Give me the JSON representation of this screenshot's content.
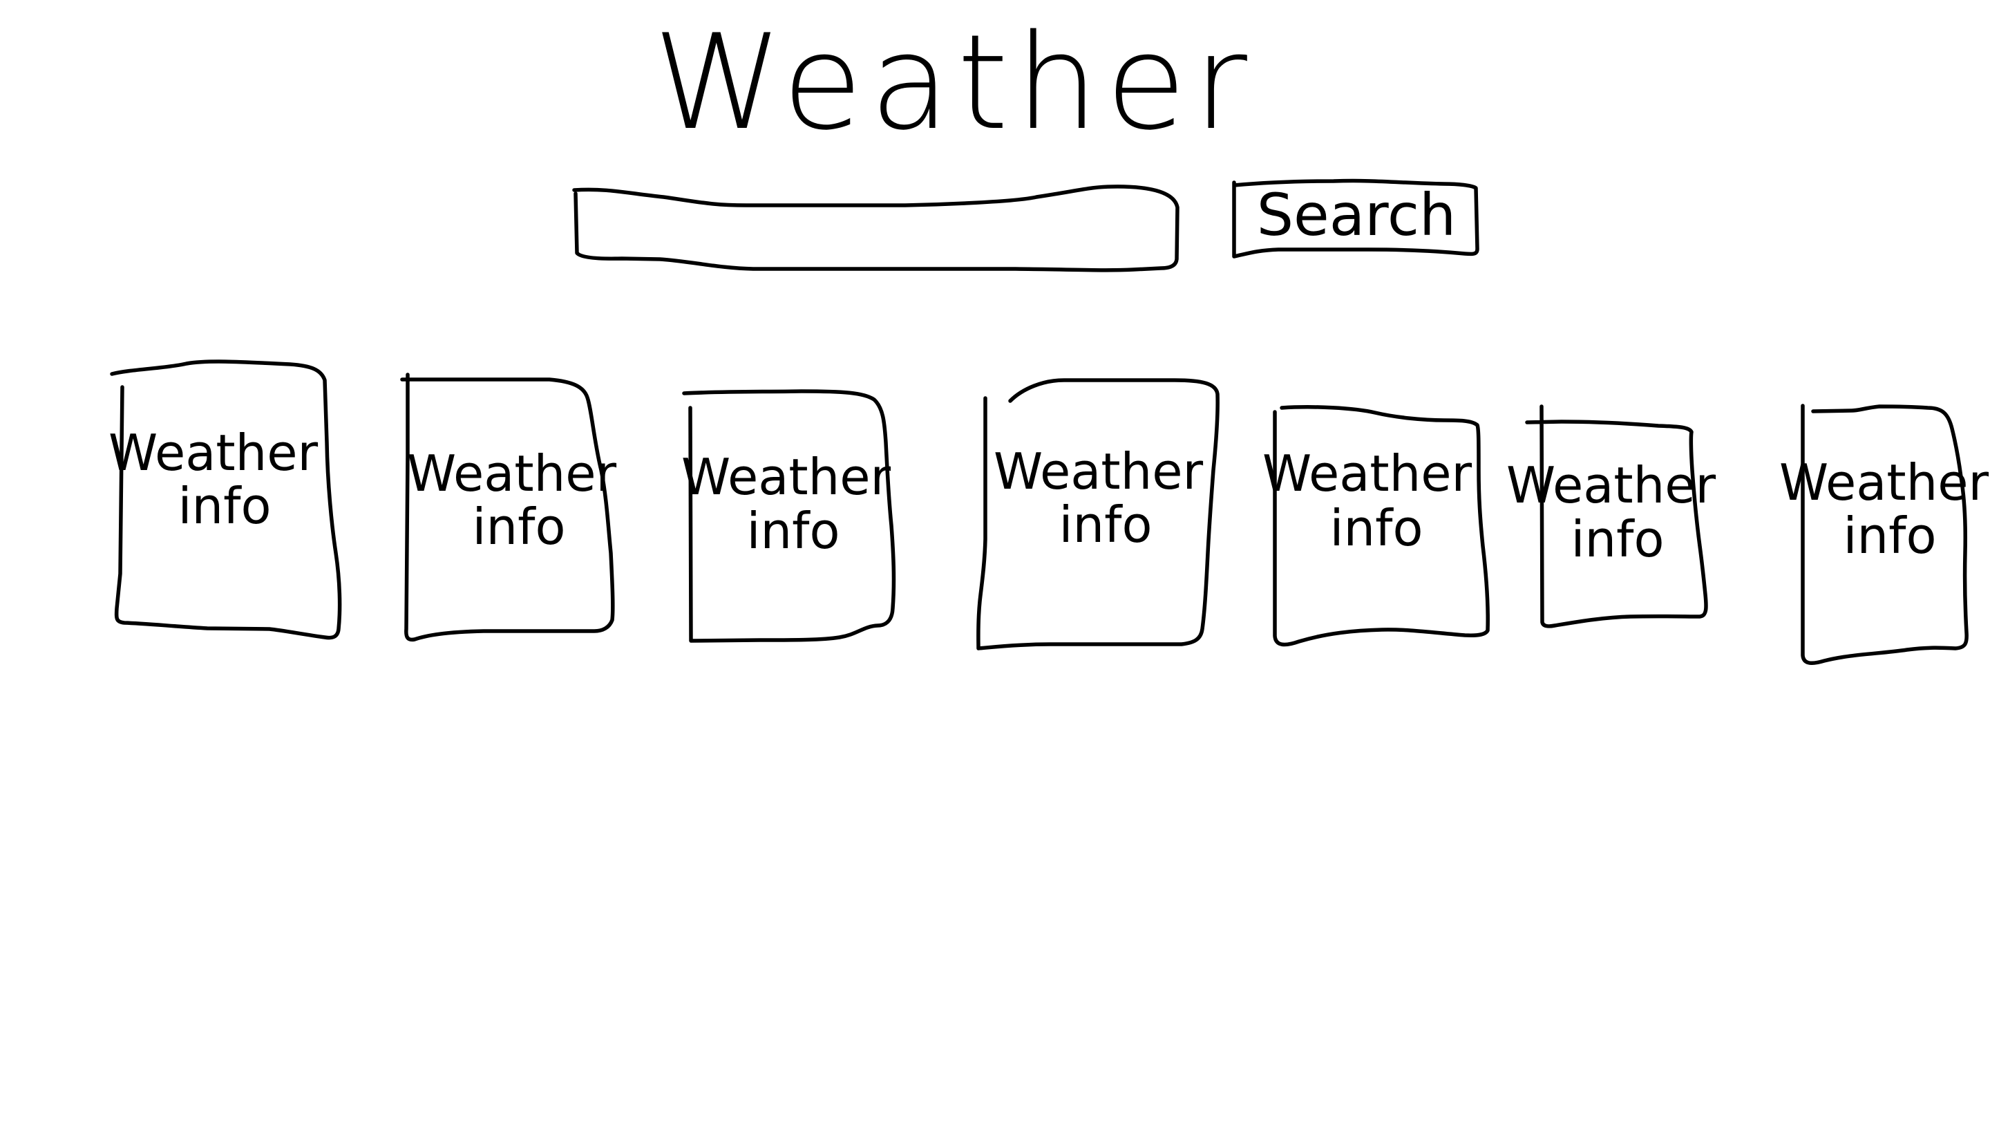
{
  "page": {
    "title": "Weather"
  },
  "search": {
    "input_value": "",
    "button_label": "Search"
  },
  "cards": [
    {
      "line1": "Weather",
      "line2": "info"
    },
    {
      "line1": "Weather",
      "line2": "info"
    },
    {
      "line1": "Weather",
      "line2": "info"
    },
    {
      "line1": "Weather",
      "line2": "info"
    },
    {
      "line1": "Weather",
      "line2": "info"
    },
    {
      "line1": "Weather",
      "line2": "info"
    },
    {
      "line1": "Weather",
      "line2": "info"
    }
  ]
}
